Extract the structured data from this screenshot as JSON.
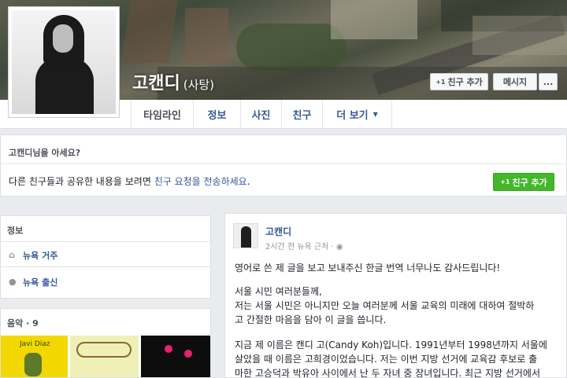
{
  "profile": {
    "name": "고캔디",
    "alt_name": "(사탕)"
  },
  "cover_actions": {
    "add_friend": "친구 추가",
    "message": "메시지",
    "more": "..."
  },
  "tabs": [
    {
      "label": "타임라인"
    },
    {
      "label": "정보"
    },
    {
      "label": "사진"
    },
    {
      "label": "친구"
    },
    {
      "label": "더 보기"
    }
  ],
  "know_box": {
    "title": "고캔디님을 아세요?",
    "msg_before": "다른 친구들과 공유한 내용을 보려면 ",
    "msg_link": "친구 요청을 전송하세요",
    "msg_after": ".",
    "add_button": "친구 추가"
  },
  "info_card": {
    "header": "정보",
    "rows": [
      {
        "icon": "home-icon",
        "text": "뉴욕 거주"
      },
      {
        "icon": "location-pin-icon",
        "text": "뉴욕 출신"
      }
    ]
  },
  "music_card": {
    "header": "음악 · 9",
    "album_1_text": "Javi Diaz"
  },
  "post": {
    "author": "고캔디",
    "meta": "2시간 전 뉴욕 근처 · ",
    "paragraphs": [
      "영어로 쓴 제 글을 보고 보내주신 한글 번역 너무나도 감사드립니다!",
      "서울 시민 여러분들께,\n저는 서울 시민은 아니지만 오늘 여러분께 서울 교육의 미래에 대하여 절박하\n고 간절한 마음을 담아 이 글을 씁니다.",
      "지금 제 이름은 캔디 고(Candy Koh)입니다. 1991년부터 1998년까지 서울에\n살았을 때 이름은 고희경이었습니다. 저는 이번 지방 선거에 교육감 후보로 출\n마한 고승덕과 박유아 사이에서 난 두 자녀 중 장녀입니다. 최근 지방 선거에서"
    ]
  },
  "colors": {
    "link": "#365899",
    "green": "#42b72a",
    "background": "#e9ebee"
  }
}
